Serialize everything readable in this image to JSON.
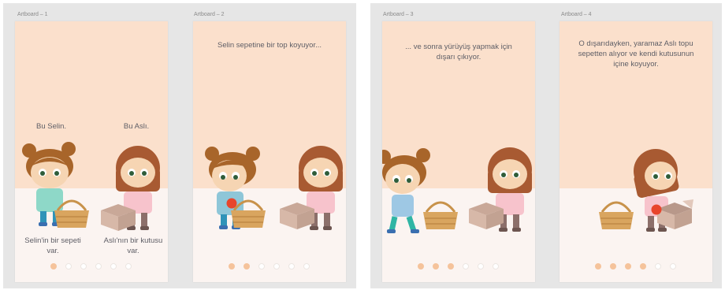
{
  "artboards": [
    {
      "label": "Artboard – 1",
      "texts": {
        "intro_left": "Bu Selin.",
        "intro_right": "Bu Aslı.",
        "caption_left": "Selin'in bir sepeti var.",
        "caption_right": "Aslı'nın bir kutusu var."
      },
      "active_dots": [
        0
      ],
      "colors": {
        "dot_active": "#f5c39b",
        "dot_inactive": "#ffffff"
      }
    },
    {
      "label": "Artboard – 2",
      "texts": {
        "top": "Selin sepetine bir top koyuyor..."
      },
      "active_dots": [
        0,
        1
      ]
    },
    {
      "label": "Artboard – 3",
      "texts": {
        "top": "... ve sonra yürüyüş yapmak için dışarı çıkıyor."
      },
      "active_dots": [
        0,
        1,
        2
      ]
    },
    {
      "label": "Artboard – 4",
      "texts": {
        "top": "O dışarıdayken, yaramaz Aslı topu sepetten alıyor ve kendi kutusunun içine koyuyor."
      },
      "active_dots": [
        0,
        1,
        2,
        3
      ]
    }
  ],
  "dot_count": 6,
  "colors": {
    "artboard_bg": "#fbe0cc",
    "floor": "#fbf4f1",
    "ball": "#e8452c",
    "basket": "#d9a55f",
    "box": "#d7b8a8"
  }
}
